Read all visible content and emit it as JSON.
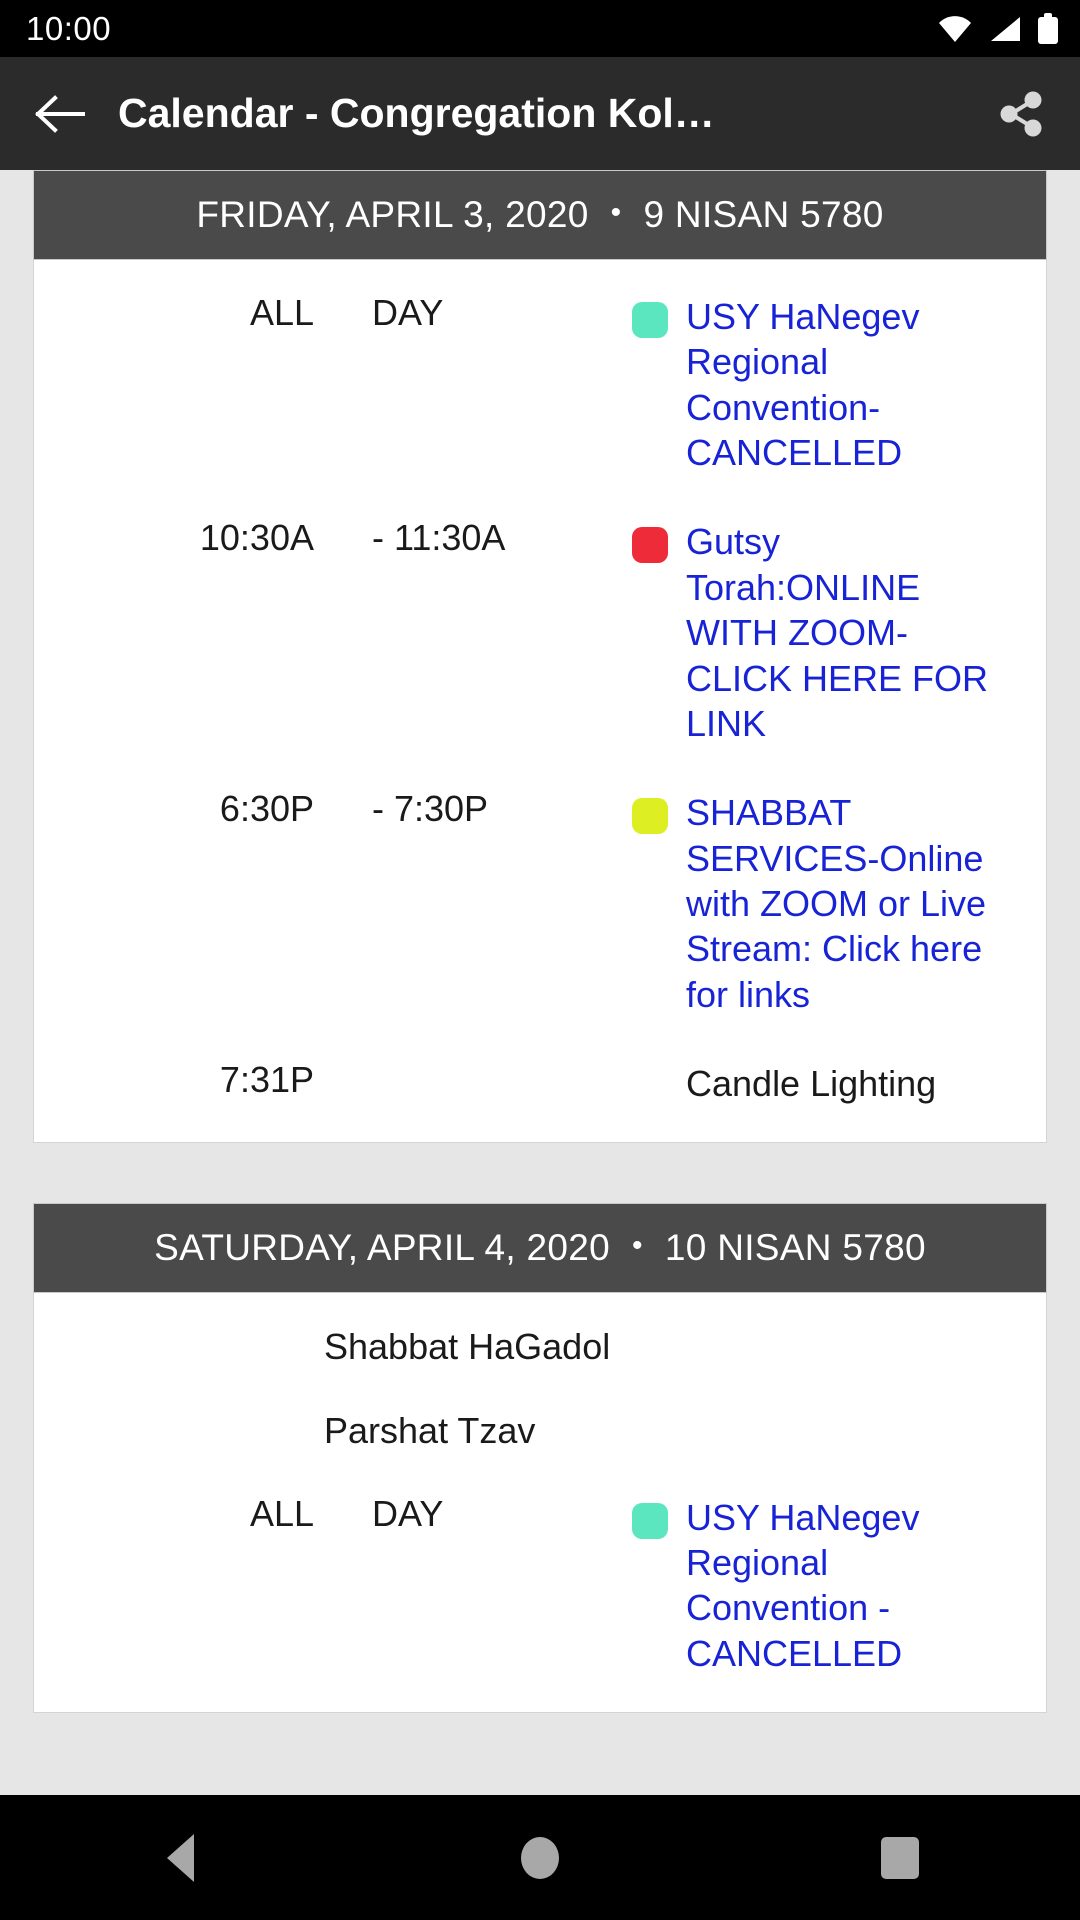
{
  "status_bar": {
    "clock": "10:00",
    "icons": [
      "wifi-icon",
      "cell-signal-icon",
      "battery-icon"
    ]
  },
  "app_bar": {
    "back_icon": "back-arrow-icon",
    "title": "Calendar - Congregation Kol…",
    "share_icon": "share-icon"
  },
  "colors": {
    "app_bar_bg": "#2b2b2b",
    "day_header_bg": "#4a4a4a",
    "page_bg": "#e6e6e6",
    "card_bg": "#ffffff",
    "link": "#1823d6",
    "text": "#1a1a1a"
  },
  "days": [
    {
      "weekday_date": "FRIDAY, APRIL 3, 2020",
      "separator": "•",
      "hebrew_date": "9 NISAN 5780",
      "notes": [],
      "events": [
        {
          "start": "ALL",
          "end": "DAY",
          "dot_color": "#5ce6c0",
          "title": "USY HaNegev Regional Convention-CANCELLED",
          "is_link": true
        },
        {
          "start": "10:30A",
          "end": "- 11:30A",
          "dot_color": "#ee2b38",
          "title": "Gutsy Torah:ONLINE WITH ZOOM-CLICK HERE FOR LINK",
          "is_link": true
        },
        {
          "start": "6:30P",
          "end": "- 7:30P",
          "dot_color": "#ddee22",
          "title": "SHABBAT SERVICES-Online with ZOOM or Live Stream: Click here for links",
          "is_link": true
        },
        {
          "start": "7:31P",
          "end": "",
          "dot_color": "",
          "title": "Candle Lighting",
          "is_link": false
        }
      ]
    },
    {
      "weekday_date": "SATURDAY, APRIL 4, 2020",
      "separator": "•",
      "hebrew_date": "10 NISAN 5780",
      "notes": [
        "Shabbat HaGadol",
        "Parshat Tzav"
      ],
      "events": [
        {
          "start": "ALL",
          "end": "DAY",
          "dot_color": "#5ce6c0",
          "title": "USY HaNegev Regional Convention - CANCELLED",
          "is_link": true
        }
      ]
    }
  ],
  "nav_bar": {
    "back": "nav-back-icon",
    "home": "nav-home-icon",
    "recents": "nav-recents-icon"
  }
}
